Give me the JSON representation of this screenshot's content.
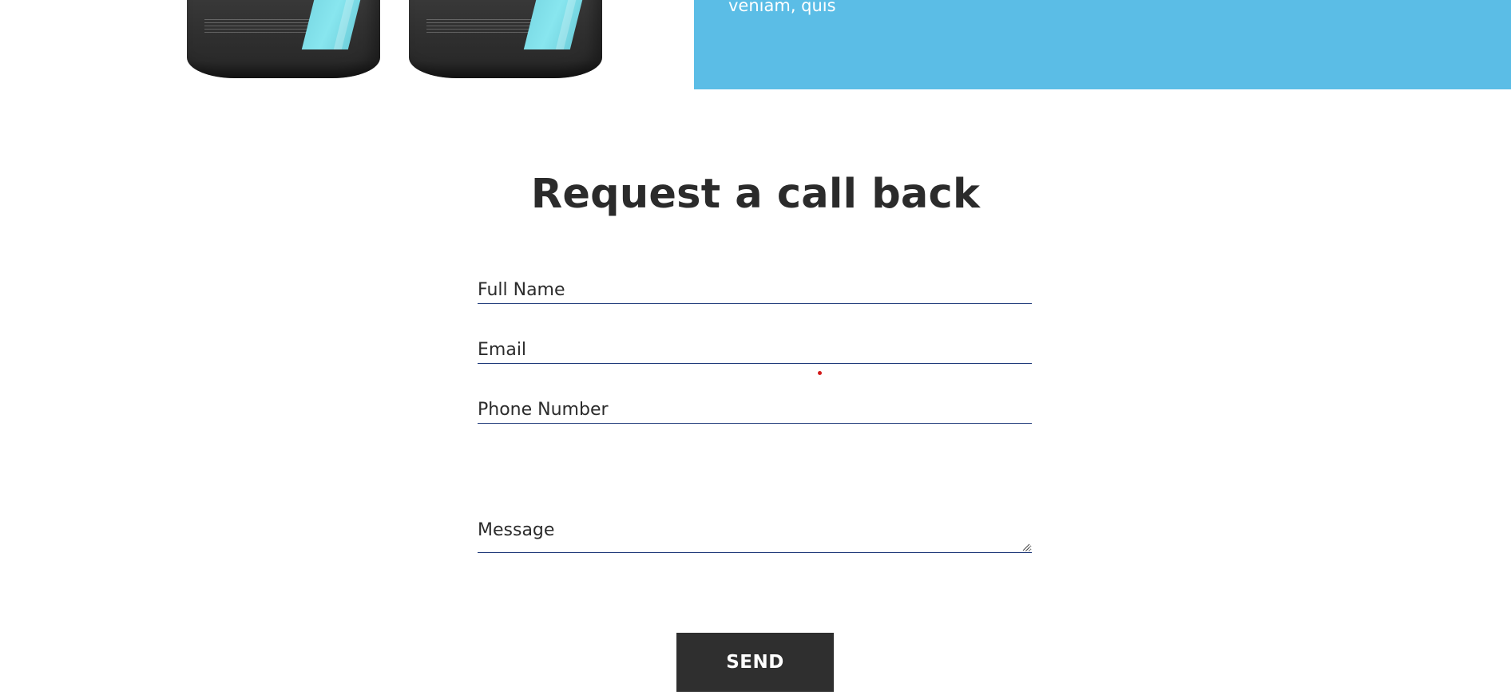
{
  "hero": {
    "blue_text": "veniam, quis",
    "colors": {
      "blue_block": "#5bbde6",
      "jar_body": "#333333",
      "jar_stripe": "#7ad9e4"
    }
  },
  "form": {
    "title": "Request a call back",
    "full_name_placeholder": "Full Name",
    "email_placeholder": "Email",
    "phone_placeholder": "Phone Number",
    "message_placeholder": "Message",
    "send_label": "SEND",
    "colors": {
      "field_underline": "#1f3a7a",
      "button_bg": "#2f2f2f"
    }
  }
}
